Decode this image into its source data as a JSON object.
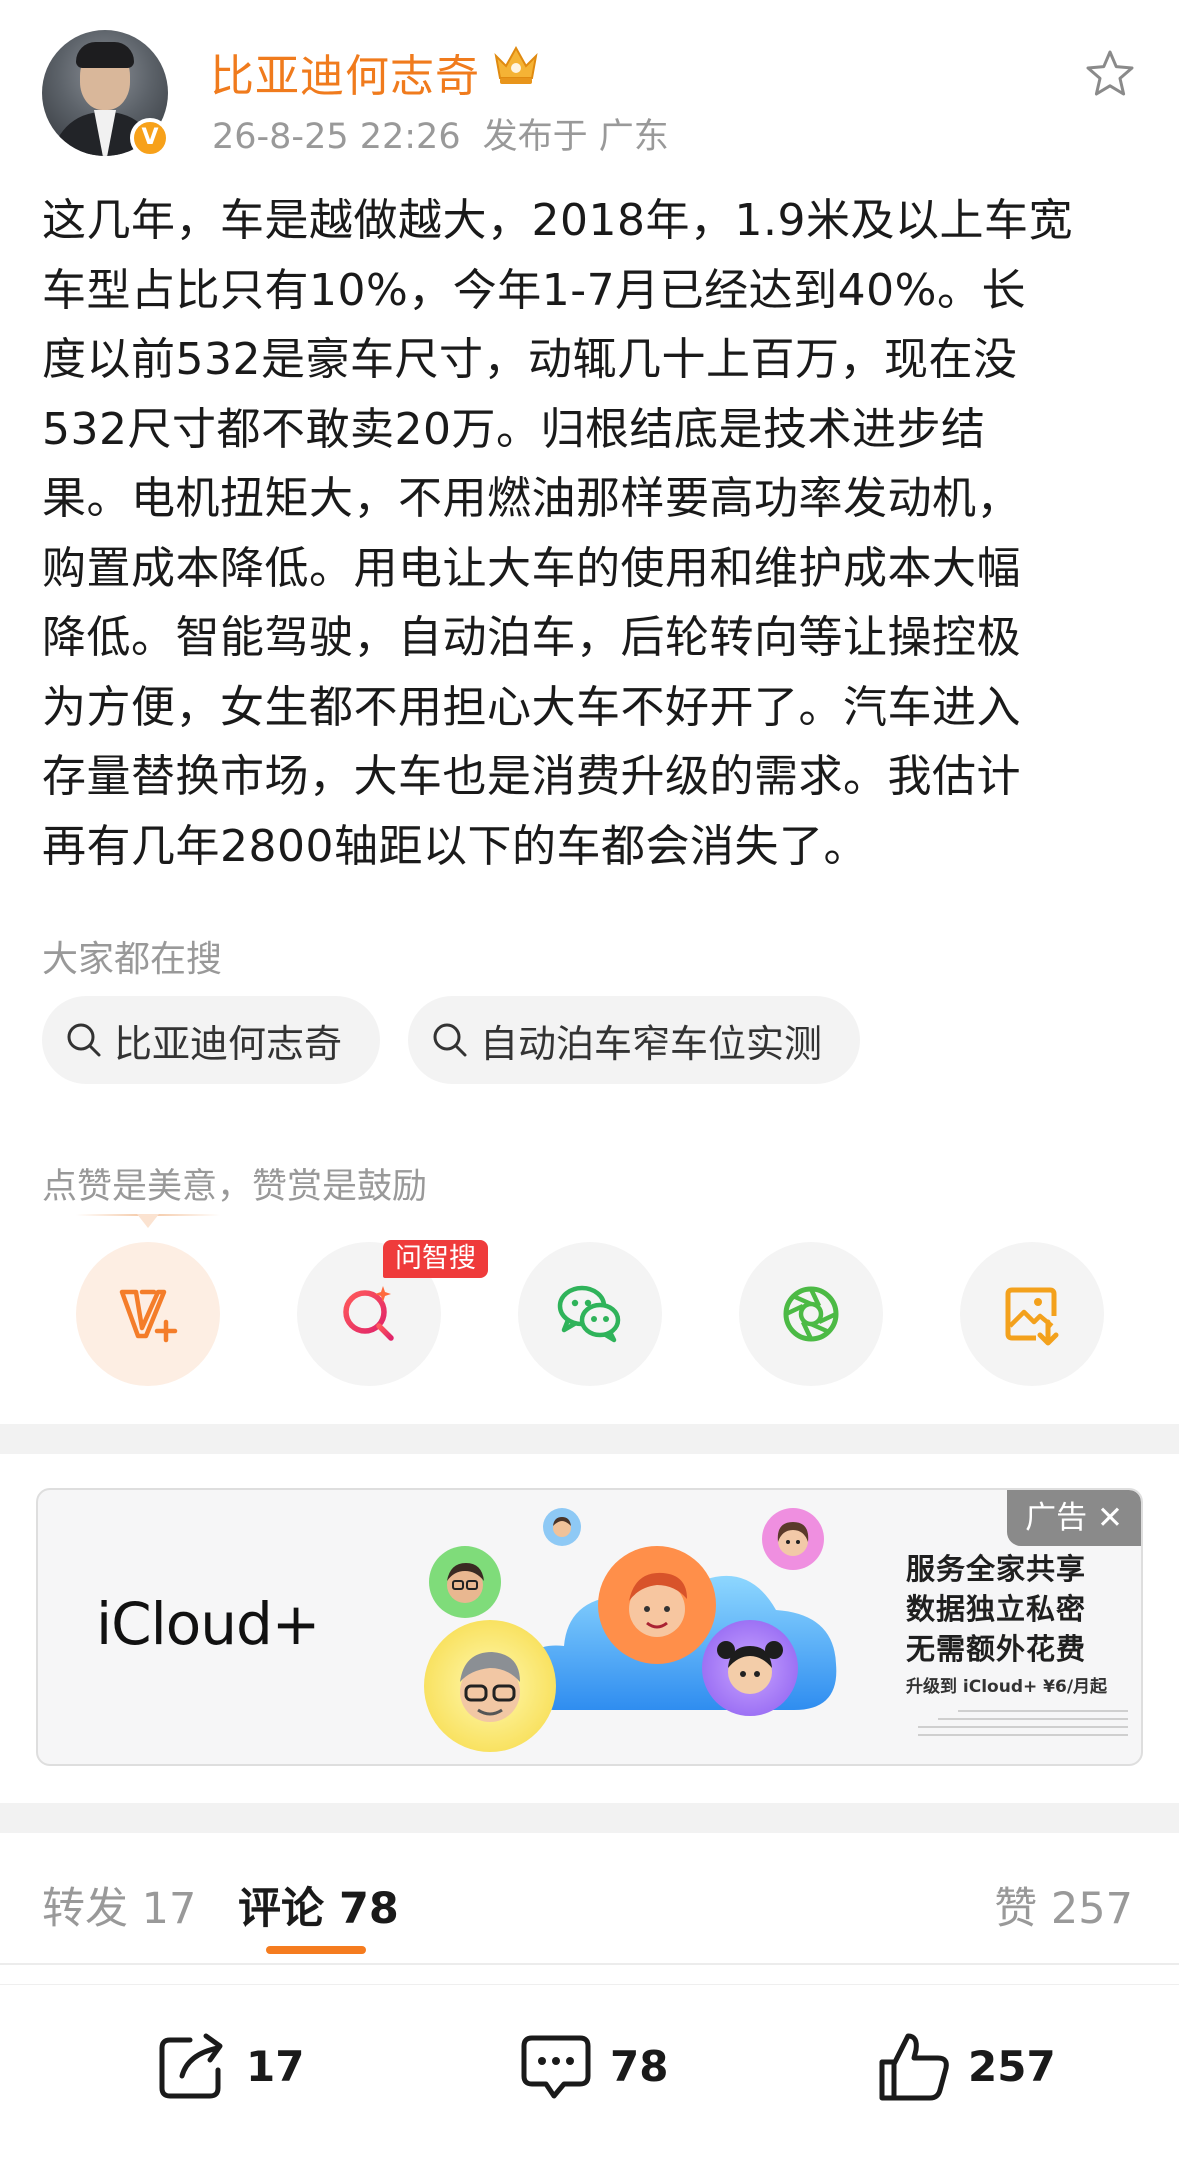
{
  "header": {
    "author": "比亚迪何志奇",
    "timestamp": "26-8-25 22:26",
    "location": "发布于 广东",
    "verified_badge": "V",
    "accent_color": "#f07b1d"
  },
  "post": {
    "text": "这几年，车是越做越大，2018年，1.9米及以上车宽\n车型占比只有10%，今年1-7月已经达到40%。长\n度以前532是豪车尺寸，动辄几十上百万，现在没\n532尺寸都不敢卖20万。归根结底是技术进步结\n果。电机扭矩大，不用燃油那样要高功率发动机，\n购置成本降低。用电让大车的使用和维护成本大幅\n降低。智能驾驶，自动泊车，后轮转向等让操控极\n为方便，女生都不用担心大车不好开了。汽车进入\n存量替换市场，大车也是消费升级的需求。我估计\n再有几年2800轴距以下的车都会消失了。"
  },
  "search": {
    "title": "大家都在搜",
    "chips": [
      "比亚迪何志奇",
      "自动泊车窄车位实测"
    ]
  },
  "praise": {
    "text": "点赞是美意，赞赏是鼓励",
    "ask_badge": "问智搜",
    "icons": [
      "reward-v-plus-icon",
      "ask-search-icon",
      "wechat-icon",
      "moments-icon",
      "save-image-icon"
    ]
  },
  "ad": {
    "tag": "广告",
    "logo": "iCloud+",
    "line1": "服务全家共享",
    "line2": "数据独立私密",
    "line3": "无需额外花费",
    "upgrade": "升级到 iCloud+ ¥6/月起"
  },
  "tabs": {
    "repost": "转发 17",
    "comment": "评论 78",
    "like": "赞 257"
  },
  "toolbar": {
    "repost_count": "17",
    "comment_count": "78",
    "like_count": "257"
  }
}
